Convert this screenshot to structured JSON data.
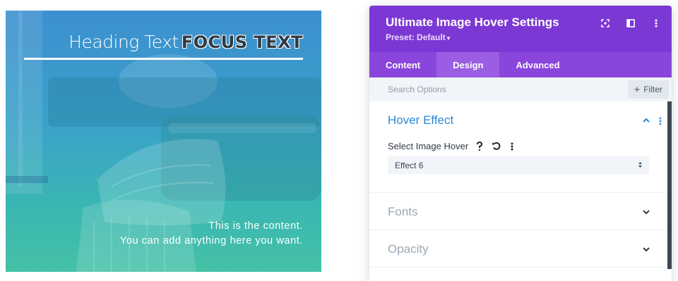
{
  "preview": {
    "heading_main": "Heading Text",
    "heading_focus": "FOCUS TEXT",
    "content_line1": "This is the content.",
    "content_line2": "You can add anything here you want."
  },
  "panel": {
    "title": "Ultimate Image Hover Settings",
    "preset": "Preset: Default",
    "header_icons": [
      "expand-icon",
      "sidebar-icon",
      "more-vertical-icon"
    ],
    "tabs": [
      {
        "label": "Content",
        "active": false
      },
      {
        "label": "Design",
        "active": true
      },
      {
        "label": "Advanced",
        "active": false
      }
    ],
    "search": {
      "placeholder": "Search Options",
      "filter_label": "Filter"
    },
    "sections": [
      {
        "title": "Hover Effect",
        "expanded": true,
        "field_label": "Select Image Hover",
        "field_icons": [
          "help-icon",
          "reset-icon",
          "more-vertical-icon"
        ],
        "select_value": "Effect 6"
      },
      {
        "title": "Fonts",
        "expanded": false
      },
      {
        "title": "Opacity",
        "expanded": false
      }
    ]
  },
  "colors": {
    "header_purple": "#7c38d4",
    "tabs_purple": "#8a45dd",
    "active_tab": "#9a5de3",
    "accent_blue": "#2b87da",
    "preview_gradient_top": "#3d8fd0",
    "preview_gradient_bottom": "#45c1a6"
  }
}
